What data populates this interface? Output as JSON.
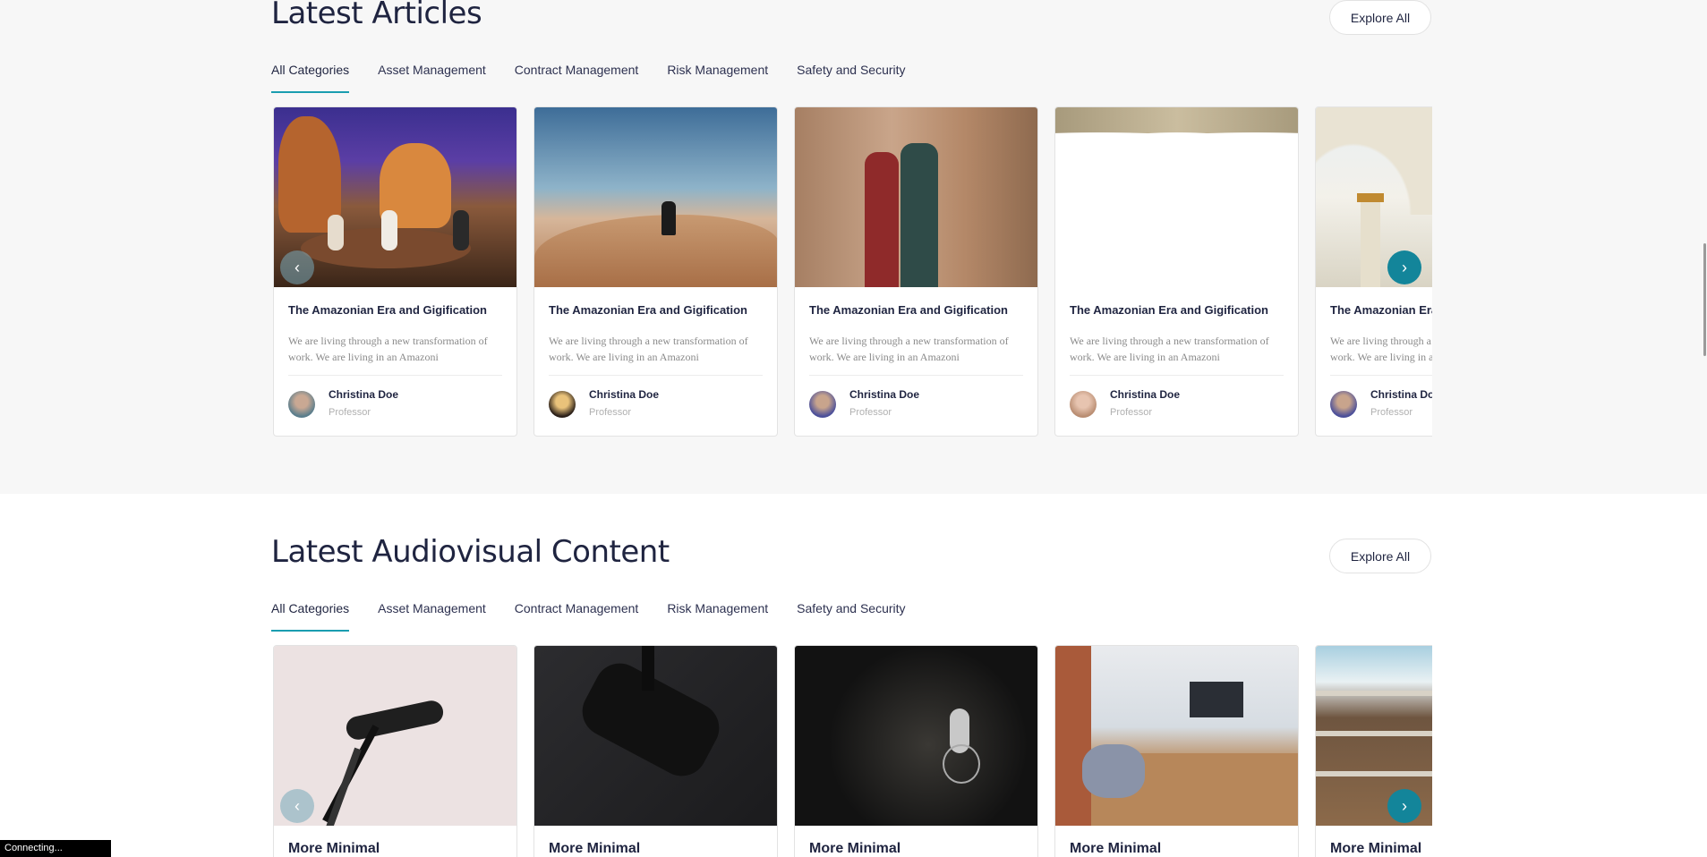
{
  "articles": {
    "title": "Latest Articles",
    "explore_label": "Explore All",
    "tabs": [
      "All Categories",
      "Asset Management",
      "Contract Management",
      "Risk Management",
      "Safety and Security"
    ],
    "cards": [
      {
        "title": "The Amazonian Era and Gigification",
        "excerpt": "We are living through a new transformation of work. We are living in an Amazoni",
        "author": "Christina Doe",
        "role": "Professor"
      },
      {
        "title": "The Amazonian Era and Gigification",
        "excerpt": "We are living through a new transformation of work. We are living in an Amazoni",
        "author": "Christina Doe",
        "role": "Professor"
      },
      {
        "title": "The Amazonian Era and Gigification",
        "excerpt": "We are living through a new transformation of work. We are living in an Amazoni",
        "author": "Christina Doe",
        "role": "Professor"
      },
      {
        "title": "The Amazonian Era and Gigification",
        "excerpt": "We are living through a new transformation of work. We are living in an Amazoni",
        "author": "Christina Doe",
        "role": "Professor"
      },
      {
        "title": "The Amazonian Era and Gigification",
        "excerpt": "We are living through a new transformation of work. We are living in an Amazoni",
        "author": "Christina Doe",
        "role": "Professor"
      }
    ]
  },
  "audiovisual": {
    "title": "Latest Audiovisual Content",
    "explore_label": "Explore All",
    "tabs": [
      "All Categories",
      "Asset Management",
      "Contract Management",
      "Risk Management",
      "Safety and Security"
    ],
    "cards": [
      {
        "title": "More Minimal"
      },
      {
        "title": "More Minimal"
      },
      {
        "title": "More Minimal"
      },
      {
        "title": "More Minimal"
      },
      {
        "title": "More Minimal"
      }
    ]
  },
  "status_text": "Connecting...",
  "colors": {
    "accent": "#1a9db0",
    "arrow": "#13859a",
    "heading": "#1f2440"
  },
  "icons": {
    "prev": "chevron-left-icon",
    "next": "chevron-right-icon"
  }
}
